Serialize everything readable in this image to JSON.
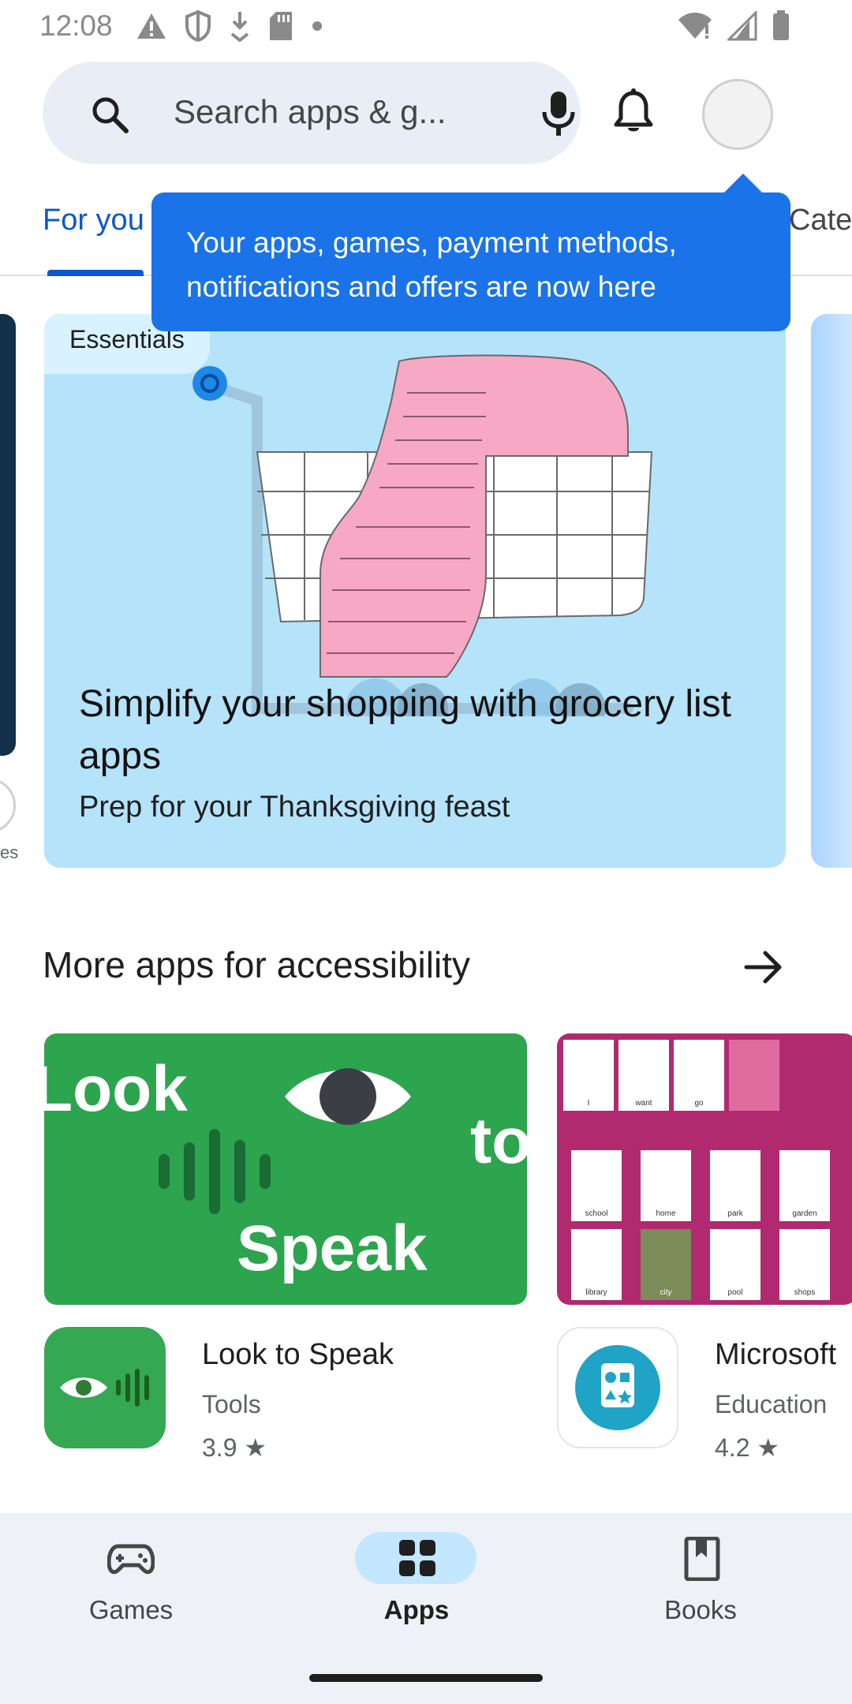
{
  "status_bar": {
    "time": "12:08",
    "icons_left": [
      "alert-icon",
      "shield-icon",
      "download-icon",
      "sd-card-icon",
      "dot-icon"
    ],
    "icons_right": [
      "wifi-icon",
      "signal-icon",
      "battery-icon"
    ]
  },
  "header": {
    "search_placeholder": "Search apps & g...",
    "icons": [
      "search-icon",
      "mic-icon",
      "bell-icon",
      "avatar"
    ]
  },
  "tabs": {
    "items": [
      {
        "label": "For you",
        "active": true
      },
      {
        "label": "Cate",
        "active": false
      }
    ]
  },
  "tooltip": {
    "text": "Your apps, games, payment methods, notifications and offers are now here"
  },
  "carousel": {
    "peek_left_label": "es",
    "feature": {
      "badge": "Essentials",
      "title": "Simplify your shopping with grocery list apps",
      "subtitle": "Prep for your Thanksgiving feast"
    }
  },
  "section": {
    "title": "More apps for accessibility",
    "banner1_words": {
      "look": "Look",
      "to": "to",
      "speak": "Speak"
    },
    "banner2_cards": [
      "I",
      "want",
      "go",
      "school",
      "home",
      "park",
      "garden",
      "library",
      "city",
      "pool",
      "shops"
    ],
    "apps": [
      {
        "name": "Look to Speak",
        "category": "Tools",
        "rating": "3.9 ★"
      },
      {
        "name": "Microsoft",
        "category": "Education",
        "rating": "4.2 ★"
      }
    ]
  },
  "bottom_nav": {
    "items": [
      {
        "label": "Games",
        "active": false,
        "icon": "gamepad-icon"
      },
      {
        "label": "Apps",
        "active": true,
        "icon": "apps-grid-icon"
      },
      {
        "label": "Books",
        "active": false,
        "icon": "bookmark-icon"
      }
    ]
  },
  "colors": {
    "accent": "#0b57d0",
    "tooltip": "#1a73e8",
    "feature_bg": "#b5e3fa",
    "look_to_speak": "#2da44e",
    "microsoft_banner": "#b12a6f"
  }
}
